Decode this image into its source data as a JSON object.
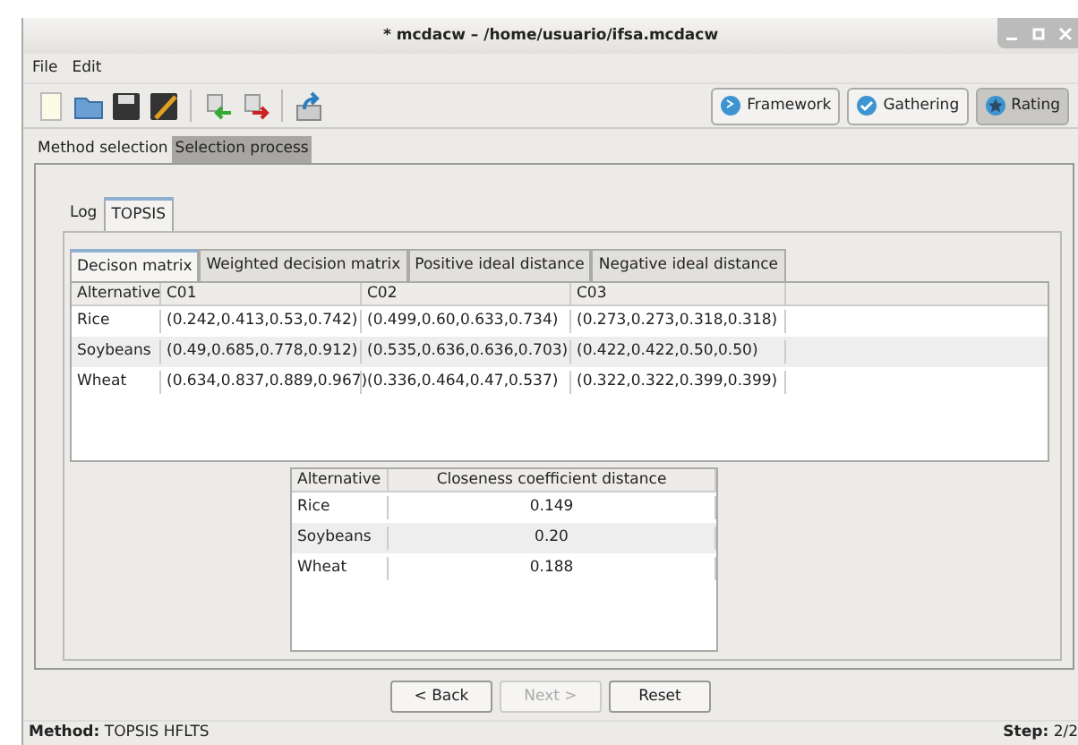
{
  "window": {
    "title": "* mcdacw – /home/usuario/ifsa.mcdacw"
  },
  "menu": [
    "File",
    "Edit"
  ],
  "toolbar": [
    {
      "kind": "new"
    },
    {
      "kind": "open"
    },
    {
      "kind": "save"
    },
    {
      "kind": "save-as"
    },
    {
      "kind": "sep"
    },
    {
      "kind": "import"
    },
    {
      "kind": "export"
    },
    {
      "kind": "sep"
    },
    {
      "kind": "upload"
    }
  ],
  "stages": [
    {
      "label": "Framework",
      "selected": false
    },
    {
      "label": "Gathering",
      "selected": false
    },
    {
      "label": "Rating",
      "selected": true
    }
  ],
  "main_tabs": [
    {
      "label": "Method selection",
      "selected": false
    },
    {
      "label": "Selection process",
      "selected": true
    }
  ],
  "inner_tabs": [
    {
      "label": "Log",
      "selected": false
    },
    {
      "label": "TOPSIS",
      "selected": true
    }
  ],
  "sub_tabs": [
    {
      "label": "Decison matrix",
      "selected": true
    },
    {
      "label": "Weighted decision matrix",
      "selected": false
    },
    {
      "label": "Positive ideal distance",
      "selected": false
    },
    {
      "label": "Negative ideal distance",
      "selected": false
    }
  ],
  "matrix": {
    "columns": [
      "Alternative",
      "C01",
      "C02",
      "C03"
    ],
    "rows": [
      [
        "Rice",
        "(0.242,0.413,0.53,0.742)",
        "(0.499,0.60,0.633,0.734)",
        "(0.273,0.273,0.318,0.318)"
      ],
      [
        "Soybeans",
        "(0.49,0.685,0.778,0.912)",
        "(0.535,0.636,0.636,0.703)",
        "(0.422,0.422,0.50,0.50)"
      ],
      [
        "Wheat",
        "(0.634,0.837,0.889,0.967)",
        "(0.336,0.464,0.47,0.537)",
        "(0.322,0.322,0.399,0.399)"
      ]
    ]
  },
  "closeness": {
    "columns": [
      "Alternative",
      "Closeness coefficient distance"
    ],
    "rows": [
      [
        "Rice",
        "0.149"
      ],
      [
        "Soybeans",
        "0.20"
      ],
      [
        "Wheat",
        "0.188"
      ]
    ]
  },
  "buttons": [
    {
      "label": "< Back",
      "disabled": false
    },
    {
      "label": "Next >",
      "disabled": true
    },
    {
      "label": "Reset",
      "disabled": false
    }
  ],
  "status_bar": {
    "left_label": "Method:",
    "left_value": "TOPSIS HFLTS",
    "right_label": "Step:",
    "right_value": "2/2"
  }
}
